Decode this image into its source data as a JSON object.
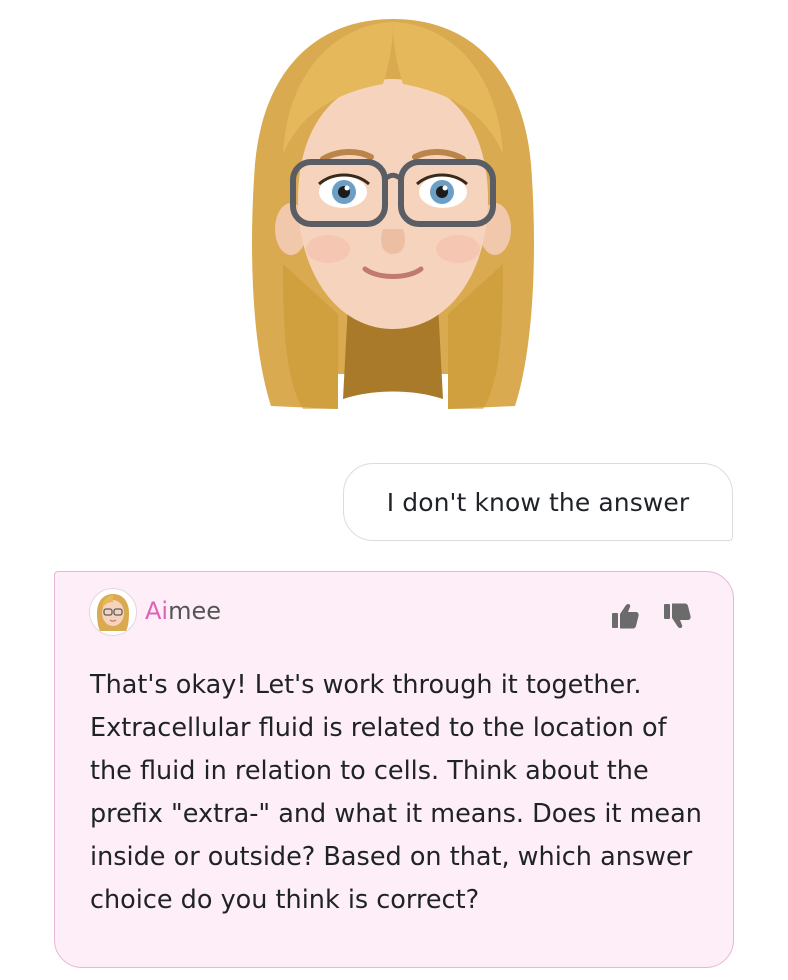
{
  "user_message": {
    "text": "I don't know the answer"
  },
  "assistant": {
    "name_prefix": "Ai",
    "name_suffix": "mee",
    "message": "That's okay! Let's work through it together. Extracellular fluid is related to the location of the fluid in relation to cells. Think about the prefix \"extra-\" and what it means. Does it mean inside or outside? Based on that, which answer choice do you think is correct?",
    "accent_color": "#e062b5"
  },
  "icons": {
    "thumbs_up": "thumbs-up-icon",
    "thumbs_down": "thumbs-down-icon"
  }
}
